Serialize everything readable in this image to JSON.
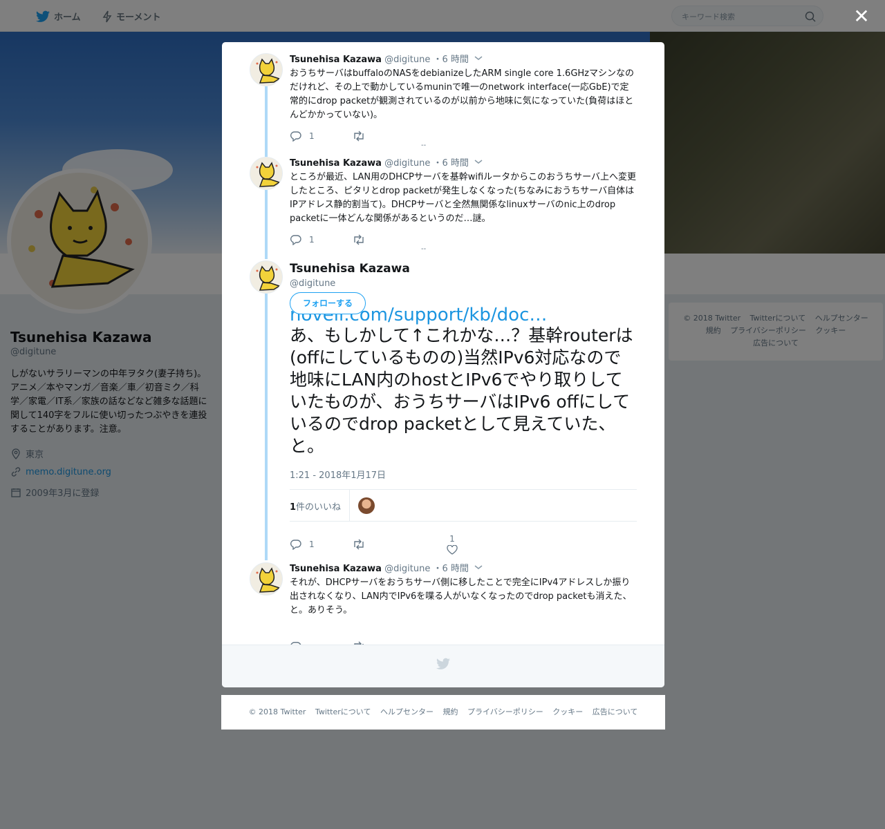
{
  "nav": {
    "home_label": "ホーム",
    "moments_label": "モーメント",
    "search_placeholder": "キーワード検索"
  },
  "profile": {
    "name": "Tsunehisa Kazawa",
    "handle": "@digitune",
    "bio": "しがないサラリーマンの中年ヲタク(妻子持ち)。アニメ／本やマンガ／音楽／車／初音ミク／科学／家電／IT系／家族の話などなど雑多な話題に関して140字をフルに使い切ったつぶやきを連投することがあります。注意。",
    "location": "東京",
    "url": "memo.digitune.org",
    "joined": "2009年3月に登録"
  },
  "side_footer": {
    "items": [
      "© 2018 Twitter",
      "Twitterについて",
      "ヘルプセンター",
      "規約",
      "プライバシーポリシー",
      "クッキー",
      "広告について"
    ]
  },
  "modal": {
    "close_label": "✕",
    "tweets": [
      {
        "name": "Tsunehisa Kazawa",
        "handle": "@digitune",
        "time": "・6 時間",
        "text": "おうちサーバはbuffaloのNASをdebianizeしたARM single core 1.6GHzマシンなのだけれど、その上で動かしているmuninで唯一のnetwork interface(一応GbE)で定常的にdrop packetが観測されているのが以前から地味に気になっていた(負荷はほとんどかかっていない)。",
        "reply_count": "1",
        "extra": "--"
      },
      {
        "name": "Tsunehisa Kazawa",
        "handle": "@digitune",
        "time": "・6 時間",
        "text": "ところが最近、LAN用のDHCPサーバを基幹wifiルータからこのおうちサーバ上へ変更したところ、ピタリとdrop packetが発生しなくなった(ちなみにおうちサーバ自体はIPアドレス静的割当て)。DHCPサーバと全然無関係なlinuxサーバのnic上のdrop packetに一体どんな関係があるというのだ…謎。",
        "reply_count": "1",
        "extra": "--"
      },
      {
        "name": "Tsunehisa Kazawa",
        "handle": "@digitune",
        "time": "・6 時間",
        "text": "それが、DHCPサーバをおうちサーバ側に移したことで完全にIPv4アドレスしか振り出されなくなり、LAN内でIPv6を喋る人がいなくなったのでdrop packetも消えた、と。ありそう。",
        "reply_count": ""
      }
    ],
    "main": {
      "name": "Tsunehisa Kazawa",
      "handle": "@digitune",
      "follow_label": "フォローする",
      "link_text": "novell.com/support/kb/doc…",
      "text": "あ、もしかして↑これかな…？基幹routerは(offにしているものの)当然IPv6対応なので地味にLAN内のhostとIPv6でやり取りしていたものが、おうちサーバはIPv6 offにしているのでdrop packetとして見えていた、と。",
      "datetime": "1:21 - 2018年1月17日",
      "likes_count": "1",
      "likes_label": "件のいいね",
      "reply_count": "1",
      "like_count": "1"
    }
  },
  "bottom_footer": {
    "items": [
      "© 2018 Twitter",
      "Twitterについて",
      "ヘルプセンター",
      "規約",
      "プライバシーポリシー",
      "クッキー",
      "広告について"
    ]
  }
}
